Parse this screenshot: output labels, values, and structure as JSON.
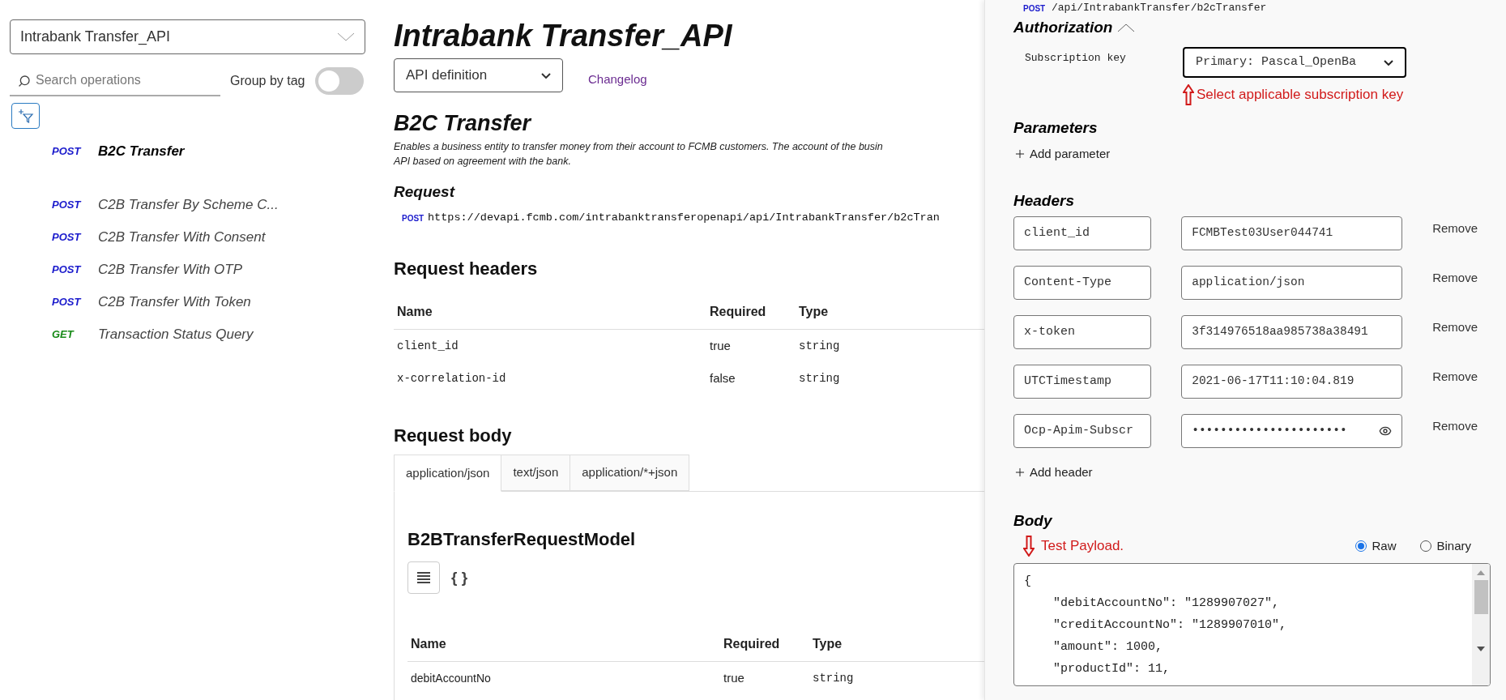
{
  "sidebar": {
    "api_select": "Intrabank Transfer_API",
    "search": {
      "placeholder": "Search operations"
    },
    "group_by_tag": {
      "label": "Group by tag",
      "on": false
    },
    "operations": [
      {
        "method": "POST",
        "color": "#1a1acc",
        "name": "B2C Transfer",
        "selected": true
      },
      {
        "method": "POST",
        "color": "#1a1acc",
        "name": "C2B Transfer By Scheme C...",
        "selected": false
      },
      {
        "method": "POST",
        "color": "#1a1acc",
        "name": "C2B Transfer With Consent",
        "selected": false
      },
      {
        "method": "POST",
        "color": "#1a1acc",
        "name": "C2B Transfer With OTP",
        "selected": false
      },
      {
        "method": "POST",
        "color": "#1a1acc",
        "name": "C2B Transfer With Token",
        "selected": false
      },
      {
        "method": "GET",
        "color": "#178a17",
        "name": "Transaction Status Query",
        "selected": false
      }
    ]
  },
  "main": {
    "title": "Intrabank Transfer_API",
    "view_select": "API definition",
    "changelog": "Changelog",
    "operation_title": "B2C Transfer",
    "description": "Enables a business entity to transfer money from their account to FCMB customers. The account of the busin",
    "description_line_2": "API based on agreement with the bank.",
    "request_heading": "Request",
    "request_method": "POST",
    "request_url": "https://devapi.fcmb.com/intrabanktransferopenapi/api/IntrabankTransfer/b2cTran",
    "headers_heading": "Request headers",
    "headers_table": {
      "columns": [
        "Name",
        "Required",
        "Type"
      ],
      "rows": [
        [
          "client_id",
          "true",
          "string"
        ],
        [
          "x-correlation-id",
          "false",
          "string"
        ]
      ]
    },
    "body_heading": "Request body",
    "body_tabs": [
      {
        "label": "application/json",
        "selected": true
      },
      {
        "label": "text/json",
        "selected": false
      },
      {
        "label": "application/*+json",
        "selected": false
      }
    ],
    "model_name": "B2BTransferRequestModel",
    "json_toggle": "{ }",
    "model_table": {
      "columns": [
        "Name",
        "Required",
        "Type"
      ],
      "rows": [
        [
          "debitAccountNo",
          "true",
          "string"
        ]
      ]
    }
  },
  "console": {
    "method": "POST",
    "path": "/api/IntrabankTransfer/b2cTransfer",
    "authorization": {
      "heading": "Authorization",
      "expanded": true,
      "key_label": "Subscription key",
      "key_value": "Primary: Pascal_OpenBa",
      "annotation": "Select applicable subscription key"
    },
    "parameters_heading": "Parameters",
    "add_parameter": "Add parameter",
    "headers_heading": "Headers",
    "headers": [
      {
        "name": "client_id",
        "value": "FCMBTest03User044741",
        "masked": false,
        "remove": "Remove"
      },
      {
        "name": "Content-Type",
        "value": "application/json",
        "masked": false,
        "remove": "Remove"
      },
      {
        "name": "x-token",
        "value": "3f314976518aa985738a38491",
        "masked": false,
        "remove": "Remove"
      },
      {
        "name": "UTCTimestamp",
        "value": "2021-06-17T11:10:04.819",
        "masked": false,
        "remove": "Remove"
      },
      {
        "name": "Ocp-Apim-Subscr",
        "value": "••••••••••••••••••••••",
        "masked": true,
        "remove": "Remove"
      }
    ],
    "add_header": "Add header",
    "body_heading": "Body",
    "body_annotation": "Test Payload.",
    "body_formats": [
      {
        "label": "Raw",
        "selected": true
      },
      {
        "label": "Binary",
        "selected": false
      }
    ],
    "body_lines": [
      "{",
      "    \"debitAccountNo\": \"1289907027\",",
      "    \"creditAccountNo\": \"1289907010\",",
      "    \"amount\": 1000,",
      "    \"productId\": 11,"
    ]
  }
}
